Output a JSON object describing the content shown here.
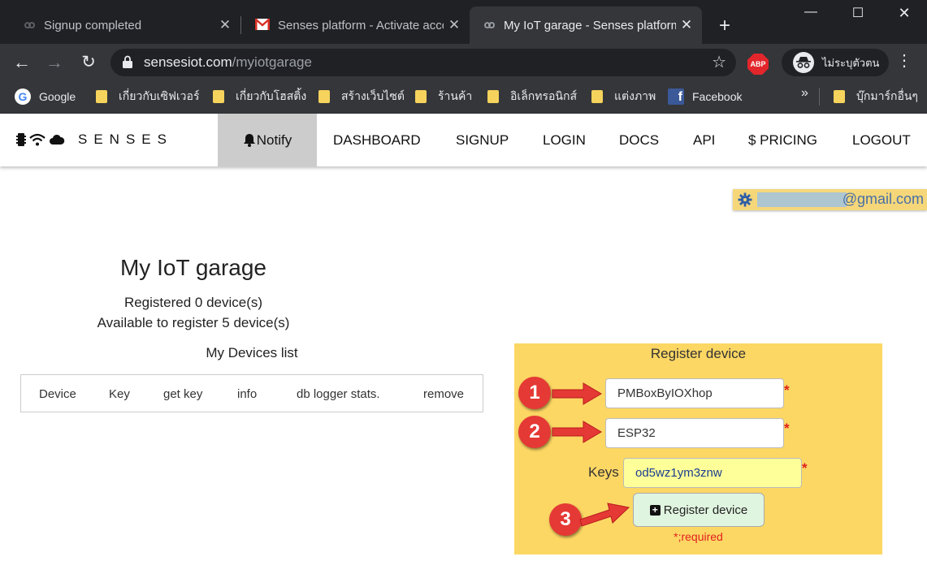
{
  "browser": {
    "tabs": [
      {
        "title": "Signup completed",
        "active": false
      },
      {
        "title": "Senses platform - Activate acco",
        "active": false
      },
      {
        "title": "My IoT garage - Senses platform",
        "active": true
      }
    ],
    "url_host": "sensesiot.com",
    "url_path": "/myiotgarage",
    "profile_label": "ไม่ระบุตัวตน",
    "abp_label": "ABP",
    "bookmarks": [
      {
        "label": "Google",
        "icon": "google-icon"
      },
      {
        "label": "เกี่ยวกับเซิฟเวอร์",
        "icon": "folder-icon"
      },
      {
        "label": "เกี่ยวกับโฮสติ้ง",
        "icon": "folder-icon"
      },
      {
        "label": "สร้างเว็บไซต์",
        "icon": "folder-icon"
      },
      {
        "label": "ร้านค้า",
        "icon": "folder-icon"
      },
      {
        "label": "อิเล็กทรอนิกส์",
        "icon": "folder-icon"
      },
      {
        "label": "แต่งภาพ",
        "icon": "folder-icon"
      },
      {
        "label": "Facebook",
        "icon": "facebook-icon"
      }
    ],
    "bookmarks_more": "»",
    "other_bookmarks": "บุ๊กมาร์กอื่นๆ",
    "colors": {
      "tabstrip": "#202124",
      "toolbar": "#35363a"
    }
  },
  "site": {
    "brand": "SENSES",
    "nav": {
      "notify": "Notify",
      "dashboard": "DASHBOARD",
      "signup": "SIGNUP",
      "login": "LOGIN",
      "docs": "DOCS",
      "api": "API",
      "pricing": "$ PRICING",
      "logout": "LOGOUT"
    },
    "email_suffix": "@gmail.com"
  },
  "garage": {
    "title": "My IoT garage",
    "registered": "Registered 0 device(s)",
    "available": "Available to register 5 device(s)",
    "devices_title": "My Devices list",
    "columns": [
      "Device",
      "Key",
      "get key",
      "info",
      "db logger stats.",
      "remove"
    ]
  },
  "register": {
    "title": "Register device",
    "device_name_value": "PMBoxByIOXhop",
    "device_type_value": "ESP32",
    "keys_label": "Keys",
    "key_value": "od5wz1ym3znw",
    "required_mark": "*",
    "button_label": "Register device",
    "required_note": "*;required",
    "colors": {
      "panel": "#fcd764",
      "button": "#e0f5e0",
      "key_field": "#ffff99",
      "required": "#e02020"
    }
  },
  "annotations": {
    "step1": "1",
    "step2": "2",
    "step3": "3",
    "color": "#e53935"
  }
}
